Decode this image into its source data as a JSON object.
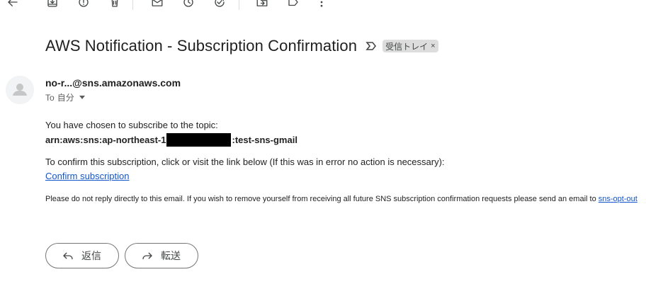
{
  "toolbar": {
    "icons": [
      "back-arrow-icon",
      "archive-icon",
      "report-spam-icon",
      "delete-icon",
      "mark-unread-icon",
      "snooze-icon",
      "add-task-icon",
      "move-to-icon",
      "label-icon",
      "more-icon"
    ]
  },
  "email": {
    "subject": "AWS Notification - Subscription Confirmation",
    "label_chip": "受信トレイ",
    "label_chip_remove": "×",
    "sender": "no-r...@sns.amazonaws.com",
    "to_prefix": "To",
    "to_name": "自分",
    "body": {
      "line1": "You have chosen to subscribe to the topic:",
      "arn_prefix": "arn:aws:sns:ap-northeast-1",
      "arn_suffix": ":test-sns-gmail",
      "line3": "To confirm this subscription, click or visit the link below (If this was in error no action is necessary):",
      "confirm_link": "Confirm subscription",
      "footer_text": "Please do not reply directly to this email. If you wish to remove yourself from receiving all future SNS subscription confirmation requests please send an email to ",
      "footer_link": "sns-opt-out"
    }
  },
  "actions": {
    "reply_label": "返信",
    "forward_label": "転送"
  }
}
